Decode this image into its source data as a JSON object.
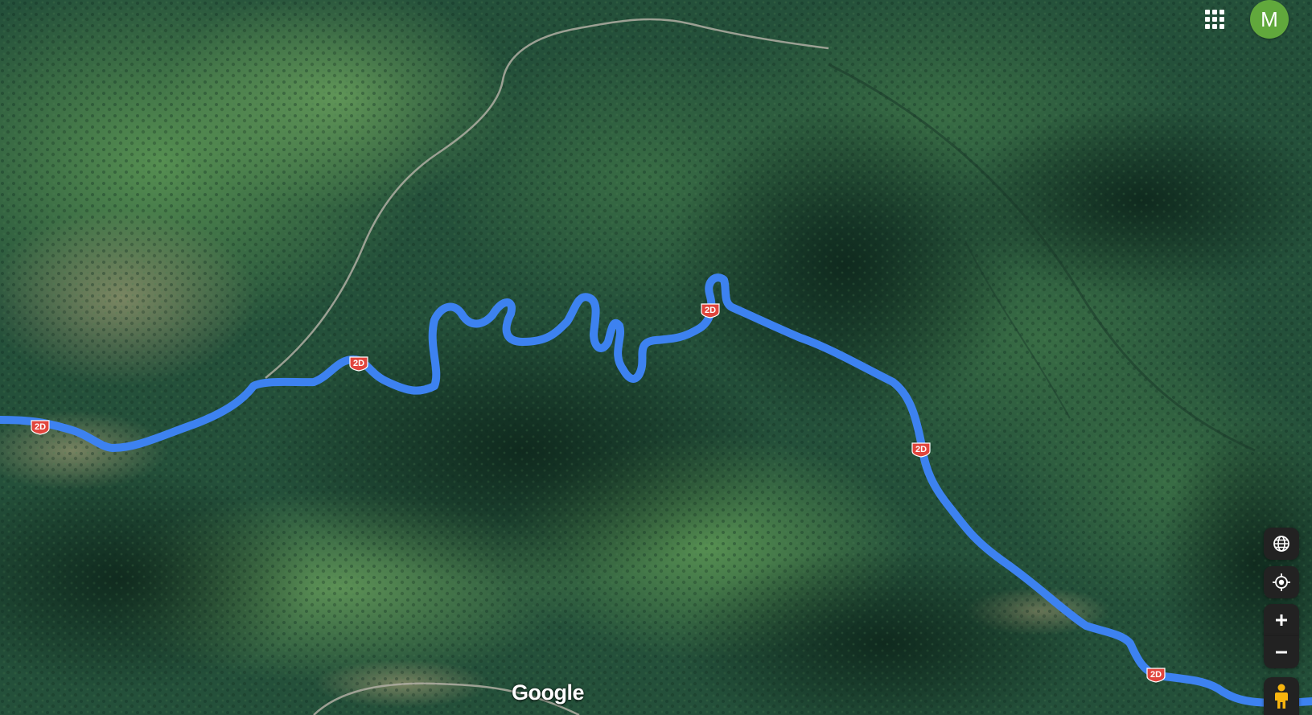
{
  "map": {
    "type": "satellite",
    "route_color": "#3d82f0",
    "route_shield": "2D",
    "shield_color": "#e1453d"
  },
  "branding": {
    "logo_text": "Google"
  },
  "account": {
    "avatar_letter": "M",
    "avatar_color": "#61a83c"
  },
  "controls": {
    "globe_icon": "globe-icon",
    "locate_icon": "my-location-icon",
    "zoom_in_label": "+",
    "zoom_out_label": "−",
    "pegman_icon": "pegman-icon",
    "apps_icon": "apps-grid-icon"
  }
}
